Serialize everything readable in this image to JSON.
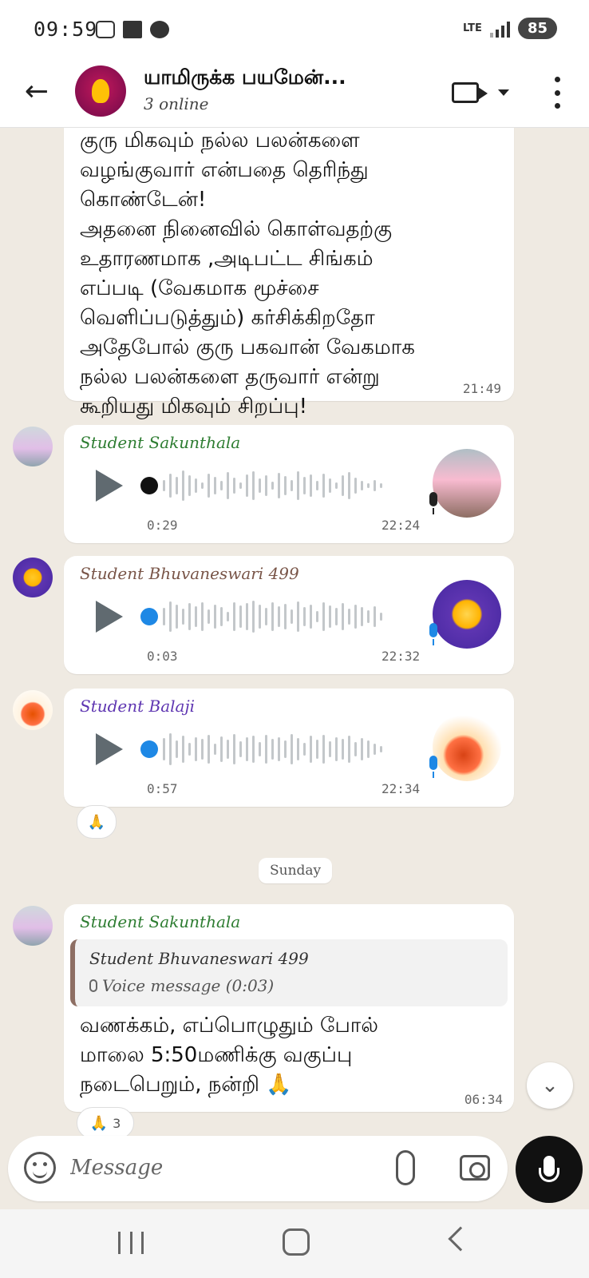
{
  "status_bar": {
    "time": "09:59",
    "network": "LTE",
    "battery": "85",
    "icons": [
      "screenshot-icon",
      "folder-icon",
      "chat-bubble-icon",
      "lte-icon",
      "signal-icon"
    ]
  },
  "header": {
    "title": "யாமிருக்க பயமேன்...",
    "subtitle": "3 online",
    "icons": [
      "back-arrow-icon",
      "video-call-icon",
      "dropdown-caret-icon",
      "more-options-icon"
    ]
  },
  "messages": [
    {
      "type": "text",
      "lines": [
        "குரு மிகவும் நல்ல பலன்களை",
        "வழங்குவார் என்பதை தெரிந்து",
        "கொண்டேன்!",
        "அதனை நினைவில் கொள்வதற்கு",
        "உதாரணமாக ,அடிபட்ட சிங்கம்",
        "எப்படி (வேகமாக மூச்சை",
        "வெளிப்படுத்தும்) கர்சிக்கிறதோ",
        "அதேபோல் குரு பகவான் வேகமாக",
        "நல்ல பலன்களை தருவார் என்று",
        "கூறியது மிகவும் சிறப்பு!"
      ],
      "time": "21:49"
    },
    {
      "type": "voice",
      "sender": "Student Sakunthala",
      "sender_color": "#2e7d32",
      "duration": "0:29",
      "time": "22:24",
      "played": true
    },
    {
      "type": "voice",
      "sender": "Student Bhuvaneswari 499",
      "sender_color": "#795548",
      "duration": "0:03",
      "time": "22:32",
      "played": false
    },
    {
      "type": "voice",
      "sender": "Student Balaji",
      "sender_color": "#5e35b1",
      "duration": "0:57",
      "time": "22:34",
      "played": false,
      "reaction": "🙏"
    },
    {
      "type": "day_separator",
      "label": "Sunday"
    },
    {
      "type": "reply",
      "sender": "Student Sakunthala",
      "sender_color": "#2e7d32",
      "quoted_sender": "Student Bhuvaneswari 499",
      "quoted_text": "Voice message (0:03)",
      "lines": [
        "வணக்கம், எப்பொழுதும் போல்",
        "மாலை 5:50மணிக்கு வகுப்பு",
        "நடைபெறும், நன்றி 🙏"
      ],
      "time": "06:34",
      "reaction": "🙏",
      "reaction_count": "3"
    }
  ],
  "composer": {
    "placeholder": "Message",
    "icons": [
      "emoji-icon",
      "attach-icon",
      "camera-icon",
      "mic-icon"
    ]
  },
  "colors": {
    "chat_background": "#efeae2",
    "unplayed_dot": "#1e88e5",
    "played_dot": "#111111",
    "mic_unplayed": "#1e88e5"
  }
}
